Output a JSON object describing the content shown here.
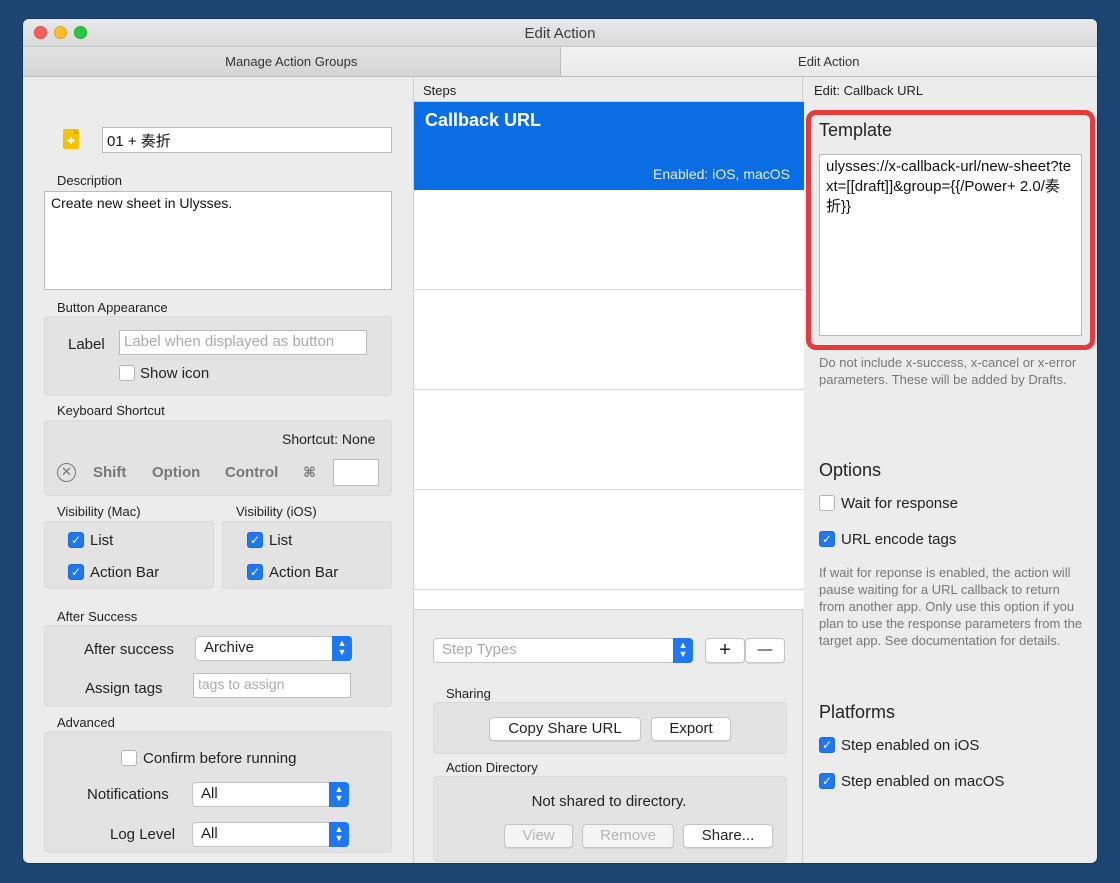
{
  "window": {
    "title": "Edit Action"
  },
  "tabs": [
    "Manage Action Groups",
    "Edit Action"
  ],
  "left": {
    "action_name": "01 + 奏折",
    "description_label": "Description",
    "description": "Create new sheet in Ulysses.",
    "button_appearance": {
      "heading": "Button Appearance",
      "label_text": "Label",
      "label_placeholder": "Label when displayed as button",
      "show_icon": "Show icon"
    },
    "keyboard_shortcut": {
      "heading": "Keyboard Shortcut",
      "shortcut": "Shortcut: None",
      "shift": "Shift",
      "option": "Option",
      "control": "Control",
      "command": "⌘"
    },
    "visibility_mac": {
      "heading": "Visibility (Mac)",
      "list": "List",
      "action_bar": "Action Bar"
    },
    "visibility_ios": {
      "heading": "Visibility (iOS)",
      "list": "List",
      "action_bar": "Action Bar"
    },
    "after_success": {
      "heading": "After Success",
      "label": "After success",
      "value": "Archive",
      "assign_tags": "Assign tags",
      "tags_placeholder": "tags to assign"
    },
    "advanced": {
      "heading": "Advanced",
      "confirm": "Confirm before running",
      "notifications_label": "Notifications",
      "notifications_value": "All",
      "log_level_label": "Log Level",
      "log_level_value": "All"
    }
  },
  "middle": {
    "steps_heading": "Steps",
    "step": {
      "title": "Callback URL",
      "enabled": "Enabled: iOS, macOS"
    },
    "step_types_placeholder": "Step Types",
    "add": "+",
    "remove": "—",
    "sharing": {
      "heading": "Sharing",
      "copy_share_url": "Copy Share URL",
      "export": "Export"
    },
    "directory": {
      "heading": "Action Directory",
      "status": "Not shared to directory.",
      "view": "View",
      "remove": "Remove",
      "share": "Share..."
    }
  },
  "right": {
    "heading": "Edit: Callback URL",
    "template_heading": "Template",
    "template": "ulysses://x-callback-url/new-sheet?text=[[draft]]&group={{/Power+ 2.0/奏折}}",
    "template_note": "Do not include x-success, x-cancel or x-error parameters. These will be added by Drafts.",
    "options_heading": "Options",
    "wait_for_response": "Wait for response",
    "url_encode_tags": "URL encode tags",
    "options_note": "If wait for reponse is enabled, the action will pause waiting for a URL callback to return from another app. Only use this option if you plan to use the response parameters from the target app. See documentation for details.",
    "platforms_heading": "Platforms",
    "step_ios": "Step enabled on iOS",
    "step_macos": "Step enabled on macOS"
  },
  "colors": {
    "accent": "#1f78ef",
    "highlight": "#e8393f",
    "background": "#1d4574"
  }
}
